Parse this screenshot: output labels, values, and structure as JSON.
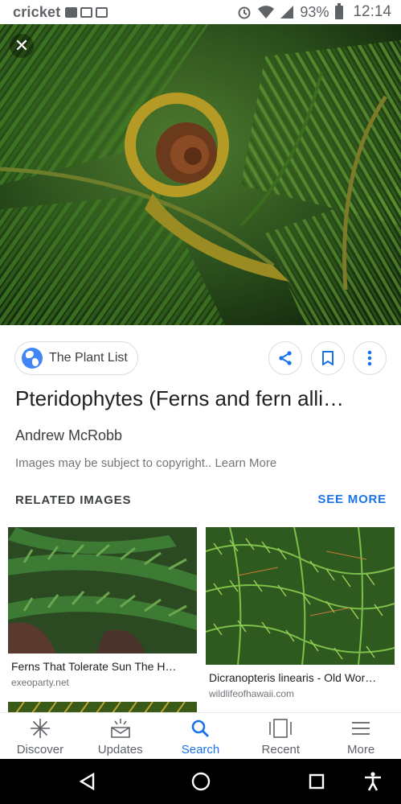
{
  "status_bar": {
    "carrier": "cricket",
    "battery_percent": "93%",
    "time": "12:14"
  },
  "hero": {
    "close_icon": "close-icon"
  },
  "source": {
    "label": "The Plant List"
  },
  "actions": {
    "share_icon": "share-icon",
    "save_icon": "bookmark-icon",
    "more_icon": "more-vert-icon"
  },
  "result": {
    "title": "Pteridophytes (Ferns and fern alli…",
    "author": "Andrew McRobb",
    "copyright": "Images may be subject to copyright.. Learn More"
  },
  "related": {
    "header": "RELATED IMAGES",
    "see_more": "SEE MORE",
    "items": [
      {
        "title": "Ferns That Tolerate Sun The H…",
        "site": "exeoparty.net"
      },
      {
        "title": "Dicranopteris linearis - Old Wor…",
        "site": "wildlifeofhawaii.com"
      }
    ]
  },
  "bottom_nav": {
    "items": [
      {
        "label": "Discover",
        "icon": "discover-icon"
      },
      {
        "label": "Updates",
        "icon": "updates-icon"
      },
      {
        "label": "Search",
        "icon": "search-icon",
        "active": true
      },
      {
        "label": "Recent",
        "icon": "recent-icon"
      },
      {
        "label": "More",
        "icon": "menu-icon"
      }
    ]
  },
  "colors": {
    "accent": "#1a73e8",
    "text_primary": "#202124",
    "text_secondary": "#70757a"
  }
}
